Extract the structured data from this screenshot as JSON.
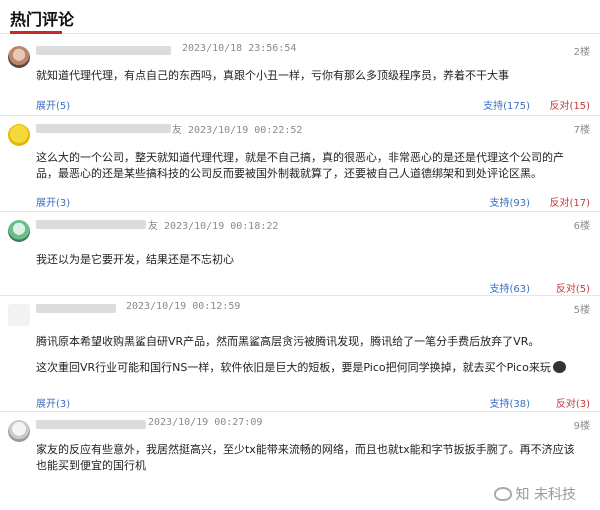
{
  "header": {
    "title": "热门评论"
  },
  "comments": [
    {
      "time": "2023/10/18 23:56:54",
      "floor": "2楼",
      "paragraphs": [
        "就知道代理代理，有点自己的东西吗，真跟个小丑一样，亏你有那么多顶级程序员，养着不干大事"
      ],
      "expand": "展开(5)",
      "support": "支持(175)",
      "oppose": "反对(15)"
    },
    {
      "time": "友 2023/10/19 00:22:52",
      "floor": "7楼",
      "paragraphs": [
        "这么大的一个公司，整天就知道代理代理，就是不自己搞，真的很恶心，非常恶心的是还是代理这个公司的产品，最恶心的还是某些搞科技的公司反而要被国外制裁就算了，还要被自己人道德绑架和到处评论区黑。"
      ],
      "expand": "展开(3)",
      "support": "支持(93)",
      "oppose": "反对(17)"
    },
    {
      "time": "友 2023/10/19 00:18:22",
      "floor": "6楼",
      "paragraphs": [
        "我还以为是它要开发，结果还是不忘初心"
      ],
      "expand": "",
      "support": "支持(63)",
      "oppose": "反对(5)"
    },
    {
      "time": "2023/10/19 00:12:59",
      "floor": "5楼",
      "paragraphs": [
        "腾讯原本希望收购黑鲨自研VR产品，然而黑鲨高层贪污被腾讯发现，腾讯给了一笔分手费后放弃了VR。",
        "这次重回VR行业可能和国行NS一样，软件依旧是巨大的短板，要是Pico把何同学换掉，就去买个Pico来玩"
      ],
      "expand": "展开(3)",
      "support": "支持(38)",
      "oppose": "反对(3)"
    },
    {
      "time": "2023/10/19 00:27:09",
      "floor": "9楼",
      "paragraphs": [
        "家友的反应有些意外，我居然挺高兴，至少tx能带来流畅的网络，而且也就tx能和字节扳扳手腕了。再不济应该也能买到便宜的国行机"
      ],
      "expand": "",
      "support": "",
      "oppose": ""
    }
  ],
  "watermark": {
    "text": "知 未科技"
  },
  "colors": {
    "accent": "#c62a2a",
    "link": "#3b6fc4",
    "oppose": "#c23b3b",
    "meta": "#8a8a8a"
  },
  "icons": [
    "avatar",
    "emoji-icon",
    "weibo-logo-icon"
  ]
}
